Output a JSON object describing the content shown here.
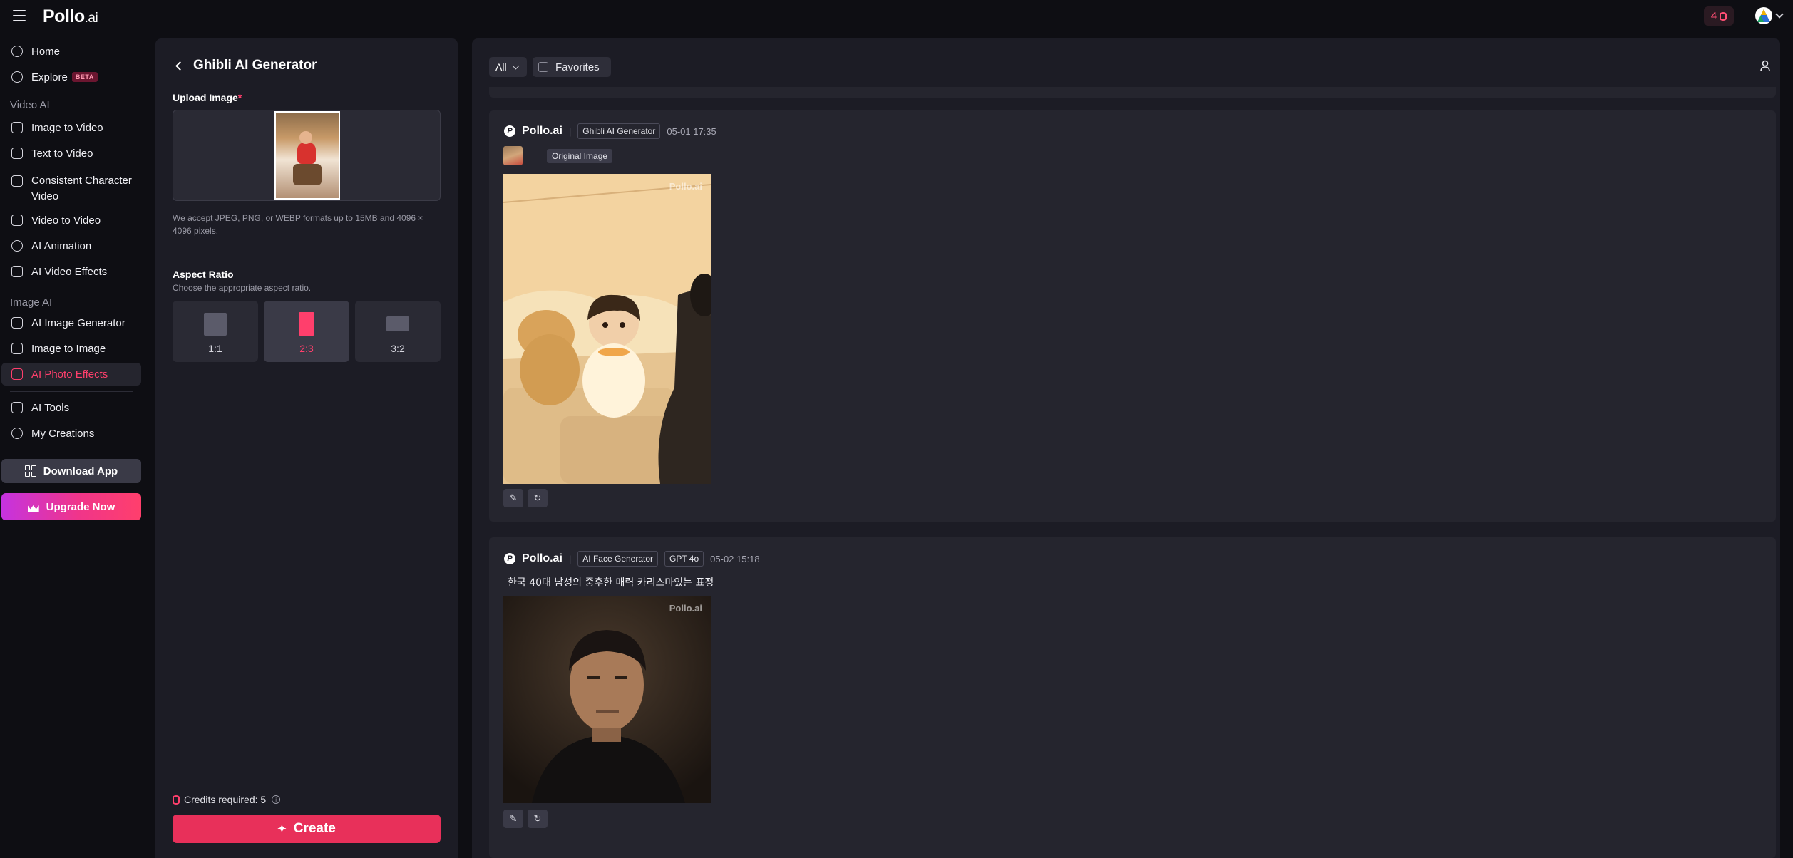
{
  "topbar": {
    "logo_main": "Pollo",
    "logo_suffix": ".ai",
    "credits": "4"
  },
  "sidebar": {
    "items": [
      {
        "label": "Home",
        "icon": "home-icon"
      },
      {
        "label": "Explore",
        "icon": "compass-icon",
        "badge": "BETA"
      },
      {
        "label": "Image to Video",
        "icon": "image-video-icon"
      },
      {
        "label": "Text to Video",
        "icon": "text-video-icon"
      },
      {
        "label": "Consistent Character Video",
        "icon": "character-icon"
      },
      {
        "label": "Video to Video",
        "icon": "video-icon"
      },
      {
        "label": "AI Animation",
        "icon": "animation-icon"
      },
      {
        "label": "AI Video Effects",
        "icon": "effects-icon"
      },
      {
        "label": "AI Image Generator",
        "icon": "image-gen-icon"
      },
      {
        "label": "Image to Image",
        "icon": "image-image-icon"
      },
      {
        "label": "AI Photo Effects",
        "icon": "photo-effects-icon"
      },
      {
        "label": "AI Tools",
        "icon": "tools-icon"
      },
      {
        "label": "My Creations",
        "icon": "user-icon"
      }
    ],
    "section_video": "Video AI",
    "section_image": "Image AI",
    "download_label": "Download App",
    "upgrade_label": "Upgrade Now"
  },
  "panel": {
    "title": "Ghibli AI Generator",
    "upload_label": "Upload Image",
    "required_mark": "*",
    "upload_note": "We accept JPEG, PNG, or WEBP formats up to 15MB and 4096 × 4096 pixels.",
    "aspect_title": "Aspect Ratio",
    "aspect_sub": "Choose the appropriate aspect ratio.",
    "aspect_options": [
      "1:1",
      "2:3",
      "3:2"
    ],
    "aspect_selected": "2:3",
    "credits_label": "Credits required: 5",
    "create_label": "Create"
  },
  "feed": {
    "filter_value": "All",
    "favorites_label": "Favorites",
    "cards": [
      {
        "brand": "Pollo.ai",
        "tool": "Ghibli AI Generator",
        "timestamp": "05-01 17:35",
        "original_label": "Original Image",
        "watermark": "Pollo.ai"
      },
      {
        "brand": "Pollo.ai",
        "tool": "AI Face Generator",
        "model": "GPT 4o",
        "timestamp": "05-02 15:18",
        "prompt": "한국 40대 남성의 중후한 매력 카리스마있는 표정",
        "watermark": "Pollo.ai"
      }
    ]
  },
  "colors": {
    "accent": "#ff3f6c",
    "background": "#0e0e13",
    "panel": "#1c1c25",
    "card": "#25252e"
  }
}
